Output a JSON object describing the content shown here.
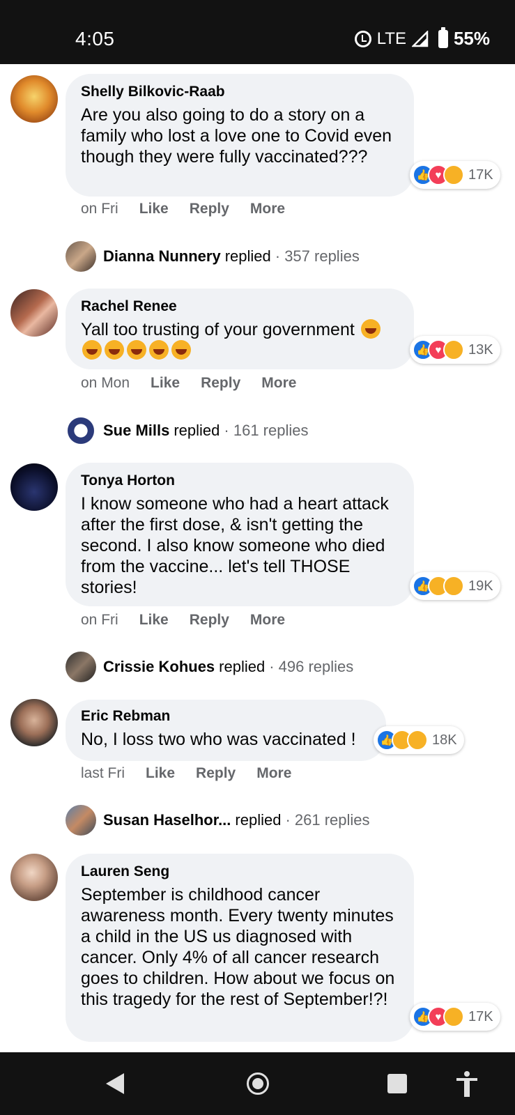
{
  "status_bar": {
    "time": "4:05",
    "network": "LTE",
    "battery": "55%"
  },
  "comments": [
    {
      "author": "Shelly Bilkovic-Raab",
      "text": "Are you also going to do a story on a family who lost a love one to Covid even though they were fully vaccinated???",
      "reactions": [
        "like",
        "love",
        "care"
      ],
      "reaction_count": "17K",
      "time": "on Fri",
      "actions": [
        "Like",
        "Reply",
        "More"
      ],
      "reply": {
        "name": "Dianna Nunnery",
        "verb": "replied",
        "count": "· 357 replies"
      }
    },
    {
      "author": "Rachel Renee",
      "text": "Yall too trusting of your government",
      "reactions": [
        "like",
        "love",
        "haha"
      ],
      "reaction_count": "13K",
      "time": "on Mon",
      "actions": [
        "Like",
        "Reply",
        "More"
      ],
      "reply": {
        "name": "Sue Mills",
        "verb": "replied",
        "count": "· 161 replies"
      }
    },
    {
      "author": "Tonya Horton",
      "text": "I know someone who had a heart attack after the first dose, & isn't getting the second. I also know someone who died from the vaccine... let's tell THOSE stories!",
      "reactions": [
        "like",
        "care",
        "sad"
      ],
      "reaction_count": "19K",
      "time": "on Fri",
      "actions": [
        "Like",
        "Reply",
        "More"
      ],
      "reply": {
        "name": "Crissie Kohues",
        "verb": "replied",
        "count": "· 496 replies"
      }
    },
    {
      "author": "Eric Rebman",
      "text": "No, I loss two who was vaccinated !",
      "reactions": [
        "like",
        "sad",
        "care"
      ],
      "reaction_count": "18K",
      "time": "last Fri",
      "actions": [
        "Like",
        "Reply",
        "More"
      ],
      "reply": {
        "name": "Susan Haselhor...",
        "verb": "replied",
        "count": "· 261 replies"
      }
    },
    {
      "author": "Lauren Seng",
      "text": "September is childhood cancer awareness month. Every twenty minutes a child in the US us diagnosed with cancer. Only 4% of all cancer research goes to children. How about we focus on this tragedy for the rest of September!?!",
      "reactions": [
        "like",
        "love",
        "care"
      ],
      "reaction_count": "17K"
    }
  ],
  "nav_bar": {
    "icons": [
      "back-icon",
      "home-icon",
      "recents-icon",
      "accessibility-icon"
    ]
  },
  "colors": {
    "bubble": "#f0f2f5",
    "secondary_text": "#65676b",
    "like_blue": "#1b74e4",
    "love_red": "#f33e58",
    "emoji_yellow": "#f7b125",
    "system_bar": "#121212"
  }
}
